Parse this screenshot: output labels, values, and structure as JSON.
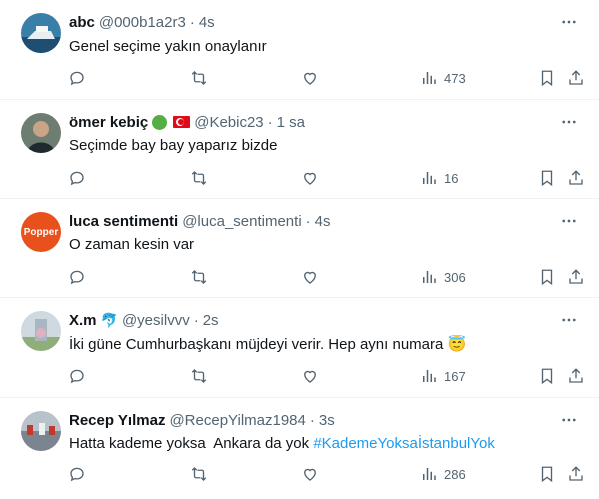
{
  "tweets": [
    {
      "name": "abc",
      "handle": "@000b1a2r3",
      "time": "4s",
      "text": "Genel seçime yakın onaylanır",
      "views": "473",
      "colors": {
        "avatar": "#3a7fa8"
      }
    },
    {
      "name": "ömer kebiç",
      "handle": "@Kebic23",
      "time": "1 sa",
      "text": "Seçimde bay bay yaparız bizde",
      "views": "16",
      "colors": {
        "avatar": "#4a5a4e"
      }
    },
    {
      "name": "luca sentimenti",
      "handle": "@luca_sentimenti",
      "time": "4s",
      "text": "O zaman kesin var",
      "views": "306",
      "avatar_text": "Popper",
      "colors": {
        "avatar": "#e8501c"
      }
    },
    {
      "name": "X.m",
      "handle": "@yesilvvv",
      "time": "2s",
      "text": "İki güne Cumhurbaşkanı müjdeyi verir. Hep aynı numara",
      "emoji": "😇",
      "views": "167",
      "colors": {
        "avatar": "#b9c7d2"
      }
    },
    {
      "name": "Recep Yılmaz",
      "handle": "@RecepYilmaz1984",
      "time": "3s",
      "text": "Hatta kademe yoksa  Ankara da yok",
      "hashtag": "#KademeYoksaİstanbulYok",
      "views": "286",
      "colors": {
        "avatar": "#8f9aa5"
      }
    }
  ],
  "separator": "·",
  "icons": [
    "more-icon",
    "reply-icon",
    "retweet-icon",
    "like-icon",
    "views-icon",
    "bookmark-icon",
    "share-icon"
  ],
  "colors": {
    "text": "#0f1419",
    "muted": "#536471",
    "link": "#1d9bf0",
    "border": "#eff3f4"
  }
}
